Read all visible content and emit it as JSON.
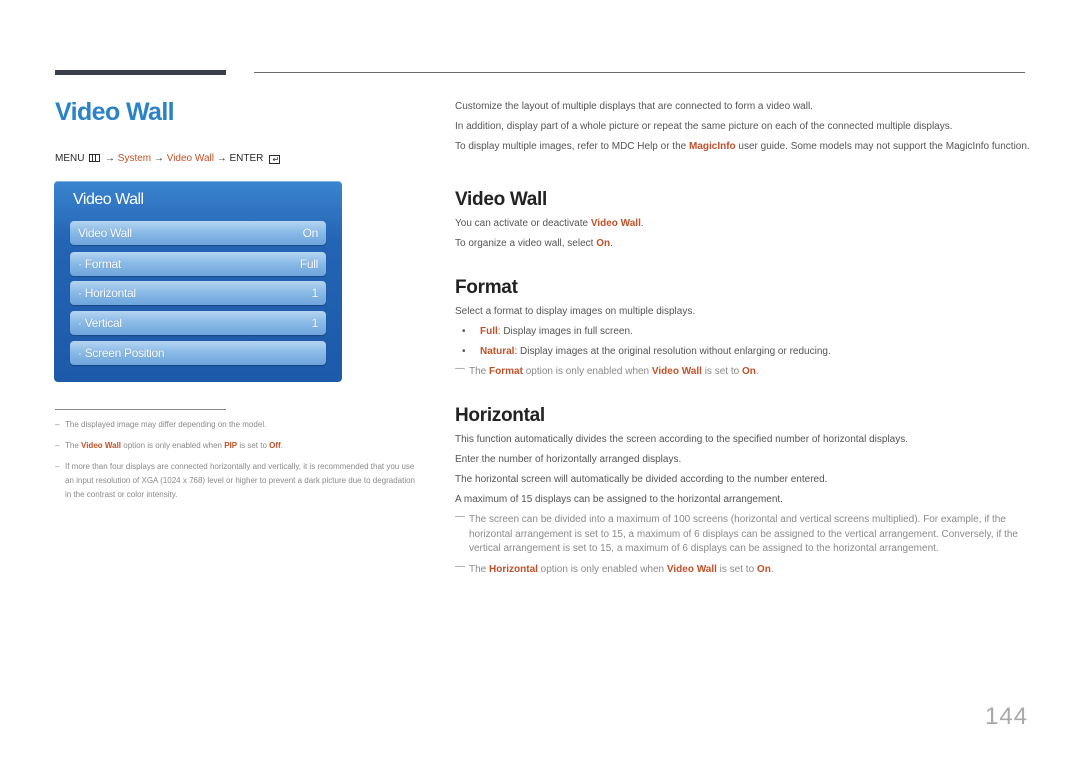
{
  "header": {
    "title": "Video Wall",
    "menu_path": {
      "menu": "MENU",
      "arrow": "→",
      "system": "System",
      "video_wall": "Video Wall",
      "enter": "ENTER",
      "menu_icon": "menu-icon",
      "enter_icon": "enter-icon"
    }
  },
  "osd": {
    "title": "Video Wall",
    "items": [
      {
        "label": "Video Wall",
        "value": "On"
      },
      {
        "label": "· Format",
        "value": "Full"
      },
      {
        "label": "· Horizontal",
        "value": "1"
      },
      {
        "label": "· Vertical",
        "value": "1"
      },
      {
        "label": "· Screen Position",
        "value": ""
      }
    ]
  },
  "footnotes": {
    "dash": "–",
    "items": [
      {
        "text": "The displayed image may differ depending on the model."
      },
      {
        "pre": "The ",
        "hl1": "Video Wall",
        "mid": " option is only enabled when ",
        "hl2": "PIP",
        "mid2": " is set to ",
        "hl3": "Off",
        "post": "."
      },
      {
        "text": "If more than four displays are connected horizontally and vertically, it is recommended that you use an input resolution of XGA (1024 x 768) level or higher to prevent a dark picture due to degradation in the contrast or color intensity."
      }
    ]
  },
  "intro": {
    "p1": "Customize the layout of multiple displays that are connected to form a video wall.",
    "p2": "In addition, display part of a whole picture or repeat the same picture on each of the connected multiple displays.",
    "p3_pre": "To display multiple images, refer to MDC Help or the ",
    "p3_hl": "MagicInfo",
    "p3_post": " user guide. Some models may not support the MagicInfo function."
  },
  "sections": {
    "video_wall": {
      "heading": "Video Wall",
      "p1_pre": "You can activate or deactivate ",
      "p1_hl": "Video Wall",
      "p1_post": ".",
      "p2_pre": "To organize a video wall, select ",
      "p2_hl": "On",
      "p2_post": "."
    },
    "format": {
      "heading": "Format",
      "p1": "Select a format to display images on multiple displays.",
      "bullet_char": "•",
      "bullets": [
        {
          "hl": "Full",
          "text": ": Display images in full screen."
        },
        {
          "hl": "Natural",
          "text": ": Display images at the original resolution without enlarging or reducing."
        }
      ],
      "note": {
        "pre": "The ",
        "hl1": "Format",
        "mid": " option is only enabled when ",
        "hl2": "Video Wall",
        "mid2": " is set to ",
        "hl3": "On",
        "post": "."
      }
    },
    "horizontal": {
      "heading": "Horizontal",
      "p1": "This function automatically divides the screen according to the specified number of horizontal displays.",
      "p2": "Enter the number of horizontally arranged displays.",
      "p3": "The horizontal screen will automatically be divided according to the number entered.",
      "p4": "A maximum of 15 displays can be assigned to the horizontal arrangement.",
      "note1": "The screen can be divided into a maximum of 100 screens (horizontal and vertical screens multiplied). For example, if the horizontal arrangement is set to 15, a maximum of 6 displays can be assigned to the vertical arrangement. Conversely, if the vertical arrangement is set to 15, a maximum of 6 displays can be assigned to the horizontal arrangement.",
      "note2": {
        "pre": "The ",
        "hl1": "Horizontal",
        "mid": " option is only enabled when ",
        "hl2": "Video Wall",
        "mid2": " is set to ",
        "hl3": "On",
        "post": "."
      }
    }
  },
  "note_dash": "—",
  "page_number": "144"
}
